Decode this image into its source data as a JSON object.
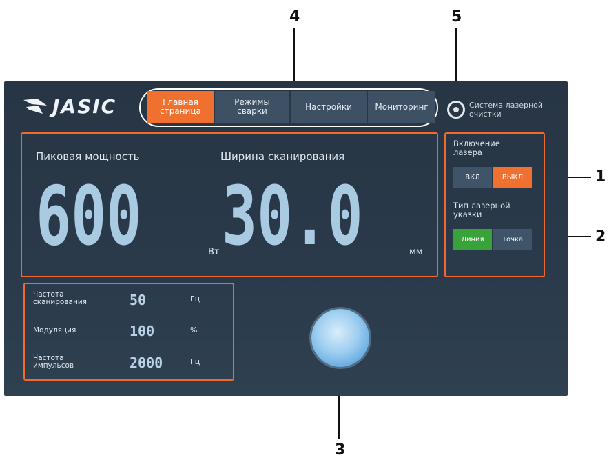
{
  "callouts": {
    "c1": "1",
    "c2": "2",
    "c3": "3",
    "c4": "4",
    "c5": "5"
  },
  "header": {
    "logo_text": "JASIC",
    "tabs": [
      {
        "label_line1": "Главная",
        "label_line2": "страница",
        "active": true
      },
      {
        "label_line1": "Режимы",
        "label_line2": "сварки",
        "active": false
      },
      {
        "label_line1": "Настройки",
        "label_line2": "",
        "active": false
      },
      {
        "label_line1": "Мониторинг",
        "label_line2": "",
        "active": false
      }
    ],
    "system_line1": "Система лазерной",
    "system_line2": "очистки"
  },
  "main": {
    "power_label": "Пиковая мощность",
    "power_value": "600",
    "power_unit": "Вт",
    "width_label": "Ширина сканирования",
    "width_value": "30.0",
    "width_unit": "мм"
  },
  "laser": {
    "title_line1": "Включение",
    "title_line2": "лазера",
    "on_label": "ВКЛ",
    "off_label": "ВЫКЛ",
    "pointer_line1": "Тип лазерной",
    "pointer_line2": "указки",
    "line_label": "Линия",
    "point_label": "Точка"
  },
  "params": [
    {
      "label_line1": "Частота",
      "label_line2": "сканирования",
      "value": "50",
      "unit": "Гц"
    },
    {
      "label_line1": "Модуляция",
      "label_line2": "",
      "value": "100",
      "unit": "%"
    },
    {
      "label_line1": "Частота",
      "label_line2": "импульсов",
      "value": "2000",
      "unit": "Гц"
    }
  ],
  "colors": {
    "accent": "#f07030",
    "panel_border": "#ef6a2c",
    "background": "#2a3a4a",
    "green": "#3aa23a"
  }
}
